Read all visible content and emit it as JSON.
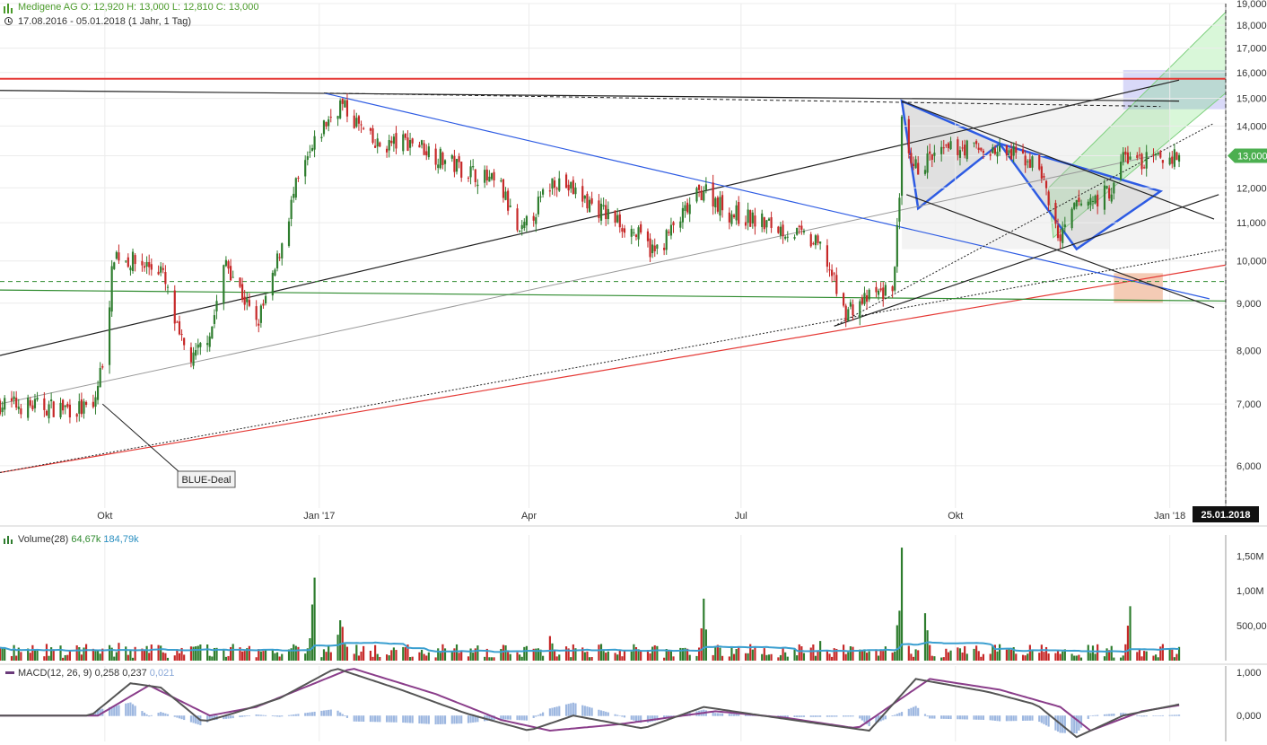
{
  "header": {
    "symbol_line": "Medigene AG  O: 12,920  H: 13,000  L: 12,810  C: 13,000",
    "range_line": "17.08.2016 - 05.01.2018   (1 Jahr, 1 Tag)",
    "bars_icon": "bar-chart-icon",
    "clock_icon": "clock-icon"
  },
  "volume_panel": {
    "label": "Volume(28)",
    "value1": "64,67k",
    "value2": "184,79k"
  },
  "macd_panel": {
    "label": "MACD(12, 26, 9)",
    "value1": "0,258",
    "value2": "0,237",
    "value3": "0,021"
  },
  "colors": {
    "up": "#2e7d2e",
    "down": "#c62828",
    "resistance": "#e53935",
    "blue_trend": "#2d5be3",
    "volume_ma": "#3a9fd0",
    "macd_line": "#555555",
    "macd_signal": "#8a3d8a",
    "hist": "#9db7e0",
    "current_price_bg": "#4caf50"
  },
  "chart_data": {
    "type": "candlestick",
    "x_range": [
      "2016-08-17",
      "2018-01-25"
    ],
    "ylim": [
      5.4,
      19.0
    ],
    "y_scale": "log",
    "x_tick_labels": [
      {
        "date": "2016-10-01",
        "label": "Okt"
      },
      {
        "date": "2017-01-01",
        "label": "Jan '17"
      },
      {
        "date": "2017-04-01",
        "label": "Apr"
      },
      {
        "date": "2017-07-01",
        "label": "Jul"
      },
      {
        "date": "2017-10-01",
        "label": "Okt"
      },
      {
        "date": "2018-01-01",
        "label": "Jan '18"
      }
    ],
    "y_tick_labels": [
      {
        "v": 19.0,
        "label": "19,000"
      },
      {
        "v": 18.0,
        "label": "18,000"
      },
      {
        "v": 17.0,
        "label": "17,000"
      },
      {
        "v": 16.0,
        "label": "16,000"
      },
      {
        "v": 15.0,
        "label": "15,000"
      },
      {
        "v": 14.0,
        "label": "14,000"
      },
      {
        "v": 13.0,
        "label": "13,000"
      },
      {
        "v": 12.0,
        "label": "12,000"
      },
      {
        "v": 11.0,
        "label": "11,000"
      },
      {
        "v": 10.0,
        "label": "10,000"
      },
      {
        "v": 9.0,
        "label": "9,000"
      },
      {
        "v": 8.0,
        "label": "8,000"
      },
      {
        "v": 7.0,
        "label": "7,000"
      },
      {
        "v": 6.0,
        "label": "6,000"
      }
    ],
    "current_price": {
      "value": 13.0,
      "label": "13,000"
    },
    "cursor_date": {
      "date": "2018-01-25",
      "label": "25.01.2018"
    },
    "annotation": {
      "label": "BLUE-Deal",
      "date": "2016-09-30",
      "value": 7.0
    },
    "price_anchors": [
      [
        "2016-08-17",
        7.0
      ],
      [
        "2016-09-26",
        6.9
      ],
      [
        "2016-10-01",
        8.0
      ],
      [
        "2016-10-05",
        10.2
      ],
      [
        "2016-10-12",
        10.0
      ],
      [
        "2016-10-25",
        9.8
      ],
      [
        "2016-11-02",
        8.2
      ],
      [
        "2016-11-08",
        7.8
      ],
      [
        "2016-11-16",
        8.5
      ],
      [
        "2016-11-22",
        10.0
      ],
      [
        "2016-12-05",
        8.5
      ],
      [
        "2016-12-12",
        9.5
      ],
      [
        "2016-12-22",
        12.0
      ],
      [
        "2017-01-03",
        14.0
      ],
      [
        "2017-01-10",
        14.8
      ],
      [
        "2017-01-25",
        13.3
      ],
      [
        "2017-02-10",
        13.5
      ],
      [
        "2017-02-25",
        12.8
      ],
      [
        "2017-03-10",
        12.4
      ],
      [
        "2017-03-20",
        12.0
      ],
      [
        "2017-03-28",
        10.6
      ],
      [
        "2017-04-05",
        11.5
      ],
      [
        "2017-04-12",
        12.3
      ],
      [
        "2017-04-28",
        11.5
      ],
      [
        "2017-05-15",
        10.8
      ],
      [
        "2017-05-25",
        10.2
      ],
      [
        "2017-06-05",
        11.1
      ],
      [
        "2017-06-15",
        12.0
      ],
      [
        "2017-06-25",
        11.3
      ],
      [
        "2017-07-10",
        11.0
      ],
      [
        "2017-07-25",
        10.7
      ],
      [
        "2017-08-05",
        10.3
      ],
      [
        "2017-08-14",
        8.8
      ],
      [
        "2017-08-28",
        9.2
      ],
      [
        "2017-09-04",
        9.3
      ],
      [
        "2017-09-07",
        11.5
      ],
      [
        "2017-09-08",
        14.0
      ],
      [
        "2017-09-12",
        12.5
      ],
      [
        "2017-09-20",
        12.9
      ],
      [
        "2017-10-03",
        13.3
      ],
      [
        "2017-10-20",
        13.1
      ],
      [
        "2017-11-01",
        12.9
      ],
      [
        "2017-11-07",
        12.5
      ],
      [
        "2017-11-10",
        11.5
      ],
      [
        "2017-11-15",
        10.5
      ],
      [
        "2017-11-22",
        11.5
      ],
      [
        "2017-12-01",
        11.7
      ],
      [
        "2017-12-08",
        12.0
      ],
      [
        "2017-12-12",
        13.0
      ],
      [
        "2017-12-20",
        12.8
      ],
      [
        "2018-01-05",
        13.0
      ]
    ],
    "volume_ylim": [
      0,
      1800000
    ],
    "volume_tick_labels": [
      {
        "v": 1500000,
        "label": "1,50M"
      },
      {
        "v": 1000000,
        "label": "1,00M"
      },
      {
        "v": 500000,
        "label": "500,00"
      }
    ],
    "volume_peaks": [
      [
        "2016-10-08",
        420000
      ],
      [
        "2016-12-30",
        1400000
      ],
      [
        "2017-01-10",
        800000
      ],
      [
        "2017-04-10",
        550000
      ],
      [
        "2017-06-15",
        900000
      ],
      [
        "2017-08-05",
        500000
      ],
      [
        "2017-09-08",
        1700000
      ],
      [
        "2017-09-18",
        800000
      ],
      [
        "2017-12-15",
        800000
      ]
    ],
    "macd_ylim": [
      -0.6,
      1.15
    ],
    "macd_tick_labels": [
      {
        "v": 1.0,
        "label": "1,000"
      },
      {
        "v": 0.0,
        "label": "0,000"
      }
    ],
    "macd_anchors": [
      [
        "2016-08-17",
        0.0
      ],
      [
        "2016-09-25",
        0.0
      ],
      [
        "2016-10-12",
        0.75
      ],
      [
        "2016-10-25",
        0.65
      ],
      [
        "2016-11-12",
        -0.15
      ],
      [
        "2016-11-25",
        0.05
      ],
      [
        "2016-12-15",
        0.4
      ],
      [
        "2017-01-08",
        1.1
      ],
      [
        "2017-02-05",
        0.6
      ],
      [
        "2017-03-05",
        0.05
      ],
      [
        "2017-04-01",
        -0.35
      ],
      [
        "2017-04-20",
        0.0
      ],
      [
        "2017-05-20",
        -0.3
      ],
      [
        "2017-06-15",
        0.2
      ],
      [
        "2017-07-10",
        0.0
      ],
      [
        "2017-08-05",
        -0.2
      ],
      [
        "2017-08-25",
        -0.35
      ],
      [
        "2017-09-14",
        0.85
      ],
      [
        "2017-10-15",
        0.55
      ],
      [
        "2017-11-05",
        0.25
      ],
      [
        "2017-11-22",
        -0.5
      ],
      [
        "2017-12-12",
        0.0
      ],
      [
        "2018-01-05",
        0.26
      ]
    ],
    "signal_anchors": [
      [
        "2016-08-17",
        0.0
      ],
      [
        "2016-09-28",
        0.0
      ],
      [
        "2016-10-20",
        0.7
      ],
      [
        "2016-11-15",
        0.0
      ],
      [
        "2016-12-05",
        0.2
      ],
      [
        "2017-01-15",
        1.1
      ],
      [
        "2017-02-20",
        0.5
      ],
      [
        "2017-03-20",
        -0.1
      ],
      [
        "2017-04-10",
        -0.35
      ],
      [
        "2017-05-10",
        -0.2
      ],
      [
        "2017-06-20",
        0.1
      ],
      [
        "2017-07-20",
        -0.05
      ],
      [
        "2017-08-20",
        -0.3
      ],
      [
        "2017-09-20",
        0.85
      ],
      [
        "2017-10-20",
        0.6
      ],
      [
        "2017-11-15",
        0.2
      ],
      [
        "2017-11-28",
        -0.35
      ],
      [
        "2017-12-20",
        0.1
      ],
      [
        "2018-01-05",
        0.24
      ]
    ],
    "lines": [
      {
        "kind": "red-resistance",
        "p1": [
          "2016-08-17",
          15.75
        ],
        "p2": [
          "2018-01-25",
          15.75
        ]
      },
      {
        "kind": "black-top",
        "p1": [
          "2016-08-17",
          15.3
        ],
        "p2": [
          "2018-01-05",
          14.9
        ]
      },
      {
        "kind": "black-up",
        "p1": [
          "2016-08-17",
          7.9
        ],
        "p2": [
          "2018-01-05",
          15.7
        ]
      },
      {
        "kind": "grey-up",
        "p1": [
          "2016-08-17",
          7.0
        ],
        "p2": [
          "2017-12-25",
          13.0
        ]
      },
      {
        "kind": "red-support",
        "p1": [
          "2016-08-17",
          5.9
        ],
        "p2": [
          "2018-01-25",
          9.9
        ]
      },
      {
        "kind": "dotted-support",
        "p1": [
          "2016-08-17",
          5.9
        ],
        "p2": [
          "2018-01-25",
          10.3
        ]
      },
      {
        "kind": "blue-down",
        "p1": [
          "2017-01-03",
          15.2
        ],
        "p2": [
          "2018-01-18",
          9.1
        ]
      },
      {
        "kind": "green-horizontal",
        "p1": [
          "2016-08-17",
          9.3
        ],
        "p2": [
          "2018-01-25",
          9.05
        ]
      },
      {
        "kind": "green-dashed",
        "p1": [
          "2016-08-17",
          9.5
        ],
        "p2": [
          "2018-01-25",
          9.5
        ]
      }
    ]
  }
}
